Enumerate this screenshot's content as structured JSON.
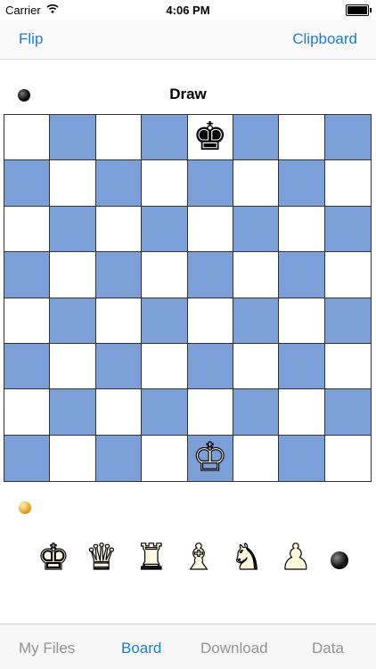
{
  "status_bar": {
    "carrier": "Carrier",
    "time": "4:06 PM"
  },
  "nav": {
    "left_label": "Flip",
    "right_label": "Clipboard"
  },
  "game_status": "Draw",
  "board": {
    "light_color": "#ffffff",
    "dark_color": "#7b9fd6",
    "pieces": [
      {
        "square": "e8",
        "glyph": "♚",
        "color": "black",
        "name": "black-king"
      },
      {
        "square": "e1",
        "glyph": "♔",
        "color": "white",
        "name": "white-king"
      }
    ]
  },
  "palette": [
    {
      "glyph": "♚",
      "name": "king"
    },
    {
      "glyph": "♛",
      "name": "queen"
    },
    {
      "glyph": "♜",
      "name": "rook"
    },
    {
      "glyph": "♝",
      "name": "bishop"
    },
    {
      "glyph": "♞",
      "name": "knight"
    },
    {
      "glyph": "♟",
      "name": "pawn"
    }
  ],
  "tabs": [
    {
      "label": "My Files",
      "active": false
    },
    {
      "label": "Board",
      "active": true
    },
    {
      "label": "Download",
      "active": false
    },
    {
      "label": "Data",
      "active": false
    }
  ]
}
